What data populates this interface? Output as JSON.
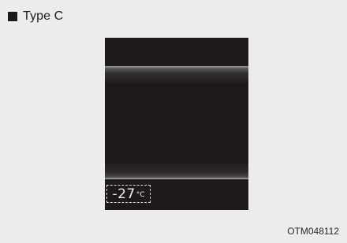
{
  "header": {
    "icon": "black-square-icon",
    "label": "Type C"
  },
  "display": {
    "temperature_value": "-27",
    "temperature_unit": "°C"
  },
  "figure_code": "OTM048112"
}
